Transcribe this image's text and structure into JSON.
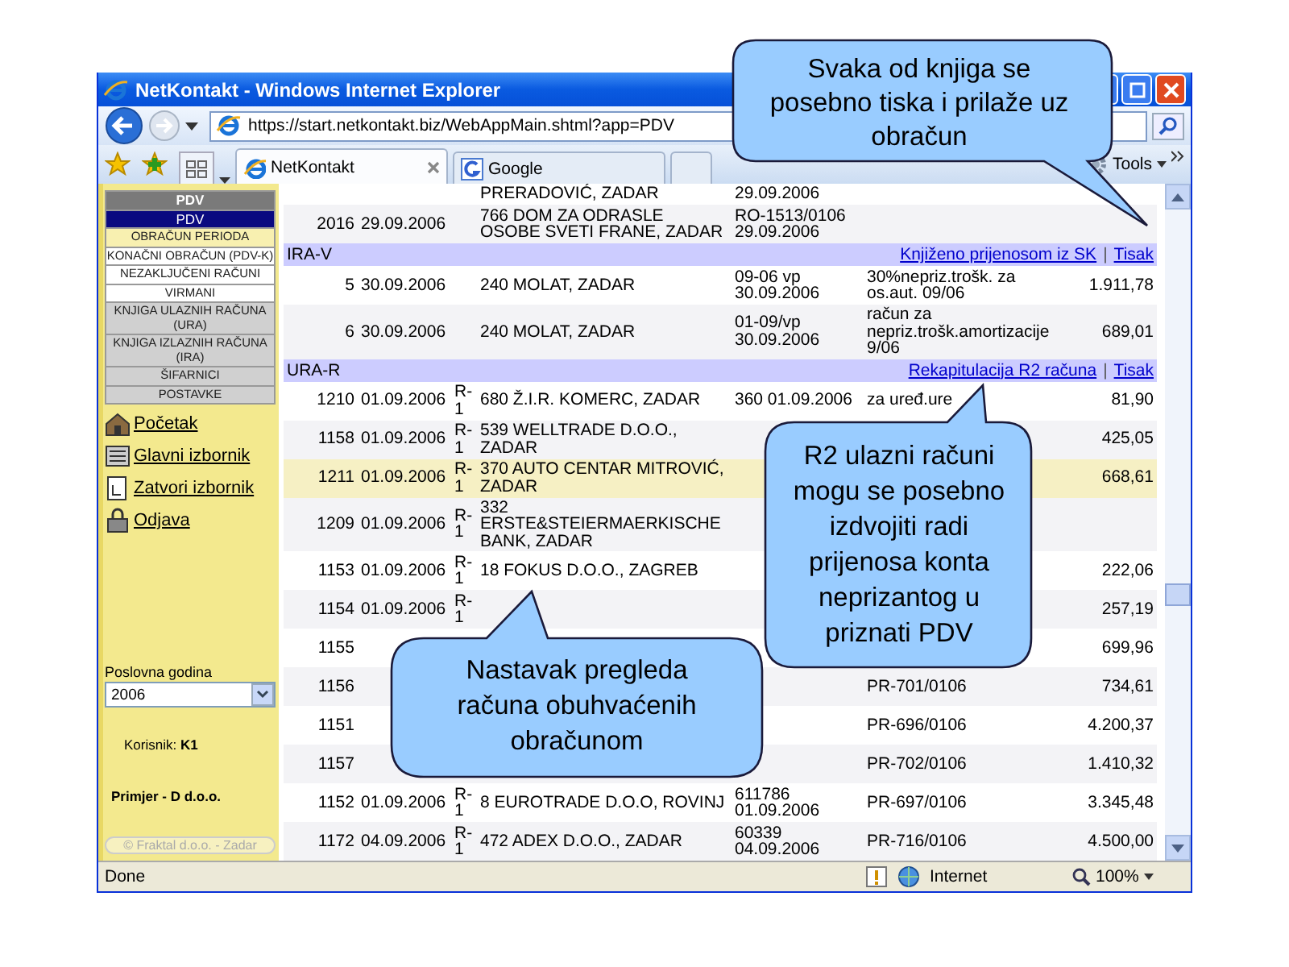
{
  "window": {
    "title": "NetKontakt - Windows Internet Explorer"
  },
  "address": {
    "url": "https://start.netkontakt.biz/WebAppMain.shtml?app=PDV"
  },
  "tabs": [
    {
      "label": "NetKontakt",
      "selected": true
    },
    {
      "label": "Google",
      "selected": false
    }
  ],
  "toolbar": {
    "tools": "Tools"
  },
  "sidebar": {
    "menu": [
      {
        "kind": "title",
        "label": "PDV",
        "selected": false
      },
      {
        "kind": "module",
        "label": "PDV",
        "selected": true
      },
      {
        "kind": "subitem",
        "label": "OBRAČUN PERIODA",
        "selected": true
      },
      {
        "kind": "subitem",
        "label": "KONAČNI OBRAČUN (PDV-K)",
        "selected": false
      },
      {
        "kind": "subitem",
        "label": "NEZAKLJUČENI RAČUNI",
        "selected": false
      },
      {
        "kind": "subitem",
        "label": "VIRMANI",
        "selected": false
      },
      {
        "kind": "module",
        "label": "KNJIGA ULAZNIH RAČUNA (URA)",
        "selected": false
      },
      {
        "kind": "module",
        "label": "KNJIGA IZLAZNIH RAČUNA (IRA)",
        "selected": false
      },
      {
        "kind": "module",
        "label": "ŠIFARNICI",
        "selected": false
      },
      {
        "kind": "module",
        "label": "POSTAVKE",
        "selected": false
      }
    ],
    "links": [
      {
        "kind": "home",
        "label": "Početak"
      },
      {
        "kind": "menu",
        "label": "Glavni izbornik"
      },
      {
        "kind": "close",
        "label": "Zatvori izbornik"
      },
      {
        "kind": "logout",
        "label": "Odjava"
      }
    ],
    "year": {
      "label": "Poslovna godina",
      "value": "2006"
    },
    "user": "Korisnik: **K1**",
    "company": "Primjer - D d.o.o.",
    "copyright": "© Fraktal d.o.o. - Zadar"
  },
  "table": {
    "rows": [
      {
        "kind": "entry",
        "highlighted": false,
        "partner": "PRERADOVIĆ, ZADAR",
        "document": "29.09.2006"
      },
      {
        "kind": "entry",
        "highlighted": false,
        "number": "2016",
        "date": "29.09.2006",
        "partner": "766 DOM ZA ODRASLE OSOBE SVETI FRANE, ZADAR",
        "document": "RO-1513/0106 29.09.2006"
      },
      {
        "kind": "section",
        "label": "IRA-V",
        "links": [
          "Knjiženo prijenosom iz SK",
          "Tisak"
        ],
        "separator": "|"
      },
      {
        "kind": "entry",
        "highlighted": false,
        "number": "5",
        "date": "30.09.2006",
        "partner": "240 MOLAT, ZADAR",
        "document": "09-06 vp 30.09.2006",
        "description": "30%nepriz.trošk. za os.aut. 09/06",
        "amount": "1.911,78"
      },
      {
        "kind": "entry",
        "highlighted": false,
        "number": "6",
        "date": "30.09.2006",
        "partner": "240 MOLAT, ZADAR",
        "document": "01-09/vp 30.09.2006",
        "description": "račun za nepriz.trošk.amortizacije 9/06",
        "amount": "689,01"
      },
      {
        "kind": "section",
        "label": "URA-R",
        "links": [
          "Rekapitulacija R2 računa",
          "Tisak"
        ],
        "separator": "|"
      },
      {
        "kind": "entry",
        "highlighted": false,
        "number": "1210",
        "date": "01.09.2006",
        "type": "R-1",
        "partner": "680 Ž.I.R. KOMERC, ZADAR",
        "document": "360 01.09.2006",
        "description": "za uređ.ure",
        "amount": "81,90"
      },
      {
        "kind": "entry",
        "highlighted": false,
        "number": "1158",
        "date": "01.09.2006",
        "type": "R-1",
        "partner": "539 WELLTRADE D.O.O., ZADAR",
        "amount": "425,05"
      },
      {
        "kind": "entry",
        "highlighted": true,
        "number": "1211",
        "date": "01.09.2006",
        "type": "R-1",
        "partner": "370 AUTO CENTAR MITROVIĆ, ZADAR",
        "amount": "668,61"
      },
      {
        "kind": "entry",
        "highlighted": false,
        "number": "1209",
        "date": "01.09.2006",
        "type": "R-1",
        "partner": "332 ERSTE&STEIERMAERKISCHE BANK, ZADAR"
      },
      {
        "kind": "entry",
        "highlighted": false,
        "number": "1153",
        "date": "01.09.2006",
        "type": "R-1",
        "partner": "18 FOKUS D.O.O., ZAGREB",
        "amount": "222,06"
      },
      {
        "kind": "entry",
        "highlighted": false,
        "number": "1154",
        "date": "01.09.2006",
        "type": "R-1",
        "amount": "257,19"
      },
      {
        "kind": "entry",
        "highlighted": false,
        "number": "1155",
        "amount": "699,96"
      },
      {
        "kind": "entry",
        "highlighted": false,
        "number": "1156",
        "description": "PR-701/0106",
        "amount": "734,61"
      },
      {
        "kind": "entry",
        "highlighted": false,
        "number": "1151",
        "description": "PR-696/0106",
        "amount": "4.200,37"
      },
      {
        "kind": "entry",
        "highlighted": false,
        "number": "1157",
        "description": "PR-702/0106",
        "amount": "1.410,32"
      },
      {
        "kind": "entry",
        "highlighted": false,
        "number": "1152",
        "date": "01.09.2006",
        "type": "R-1",
        "partner": "8 EUROTRADE D.O.O, ROVINJ",
        "document": "611786 01.09.2006",
        "description": "PR-697/0106",
        "amount": "3.345,48"
      },
      {
        "kind": "entry",
        "highlighted": false,
        "number": "1172",
        "date": "04.09.2006",
        "type": "R-1",
        "partner": "472 ADEX D.O.O., ZADAR",
        "document": "60339 04.09.2006",
        "description": "PR-716/0106",
        "amount": "4.500,00"
      }
    ]
  },
  "status_bar": {
    "text": "Done",
    "zone": "Internet",
    "zoom": "100%"
  },
  "callouts": [
    {
      "text": "Svaka od knjiga se posebno tiska i prilaže uz obračun"
    },
    {
      "text": "R2 ulazni računi mogu se posebno izdvojiti radi prijenosa konta neprizantog u priznati PDV"
    },
    {
      "text": "Nastavak pregleda računa obuhvaćenih obračunom"
    }
  ]
}
